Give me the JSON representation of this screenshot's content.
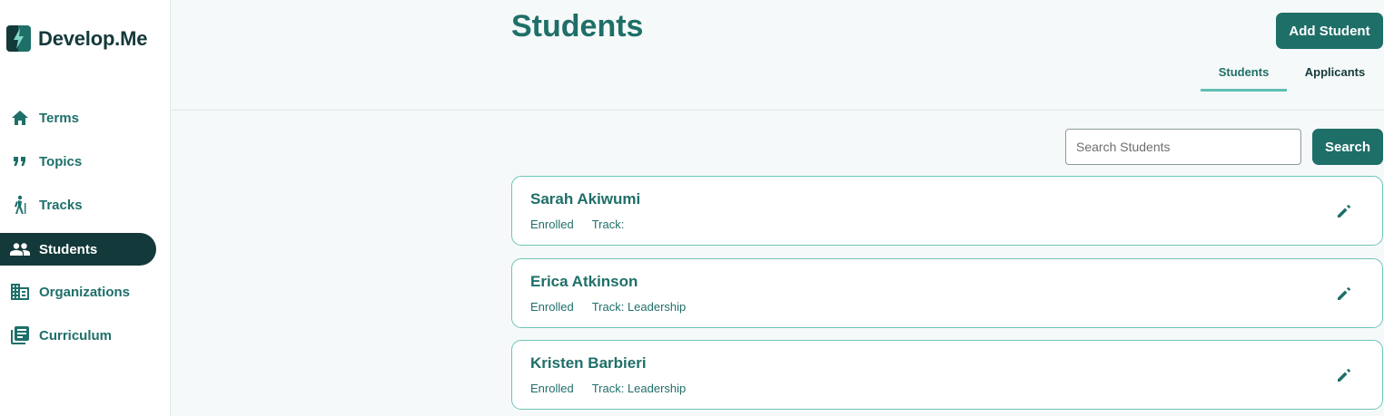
{
  "app": {
    "name": "Develop.Me"
  },
  "sidebar": {
    "items": [
      {
        "label": "Terms",
        "icon": "home-icon"
      },
      {
        "label": "Topics",
        "icon": "quote-icon"
      },
      {
        "label": "Tracks",
        "icon": "hiking-icon"
      },
      {
        "label": "Students",
        "icon": "people-icon",
        "active": true
      },
      {
        "label": "Organizations",
        "icon": "building-icon"
      },
      {
        "label": "Curriculum",
        "icon": "library-books-icon"
      }
    ]
  },
  "header": {
    "title": "Students",
    "add_button": "Add Student",
    "tabs": [
      {
        "label": "Students",
        "active": true
      },
      {
        "label": "Applicants",
        "active": false
      }
    ]
  },
  "search": {
    "placeholder": "Search Students",
    "value": "",
    "button": "Search"
  },
  "students": [
    {
      "name": "Sarah Akiwumi",
      "status": "Enrolled",
      "track": "Track:"
    },
    {
      "name": "Erica Atkinson",
      "status": "Enrolled",
      "track": "Track: Leadership"
    },
    {
      "name": "Kristen Barbieri",
      "status": "Enrolled",
      "track": "Track: Leadership"
    }
  ],
  "colors": {
    "primary": "#1f6f69",
    "dark": "#14393a",
    "accent": "#5fbfb5",
    "card_border": "#6cc4b9",
    "background": "#f6f9f9"
  }
}
